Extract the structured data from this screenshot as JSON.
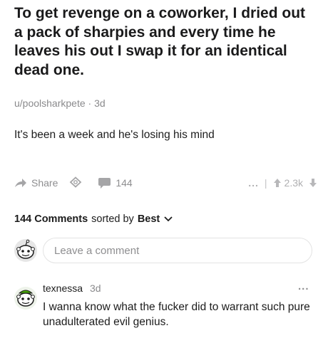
{
  "post": {
    "title": "To get revenge on a coworker, I dried out a pack of sharpies and every time he leaves his out I swap it for an identical dead one.",
    "author": "u/poolsharkpete",
    "age": "3d",
    "body": "It's been a week and he's losing his mind"
  },
  "actions": {
    "share_label": "Share",
    "comments_count": "144",
    "more_label": "...",
    "score": "2.3k",
    "colors": {
      "muted": "#8e8e90"
    }
  },
  "comments_header": {
    "count_label": "144 Comments",
    "sorted_by_label": "sorted by",
    "sort_value": "Best"
  },
  "composer": {
    "placeholder": "Leave a comment"
  },
  "comments": [
    {
      "author": "texnessa",
      "age": "3d",
      "text": "I wanna know what the fucker did to warrant such pure unadulterated evil genius.",
      "more_label": "..."
    }
  ]
}
